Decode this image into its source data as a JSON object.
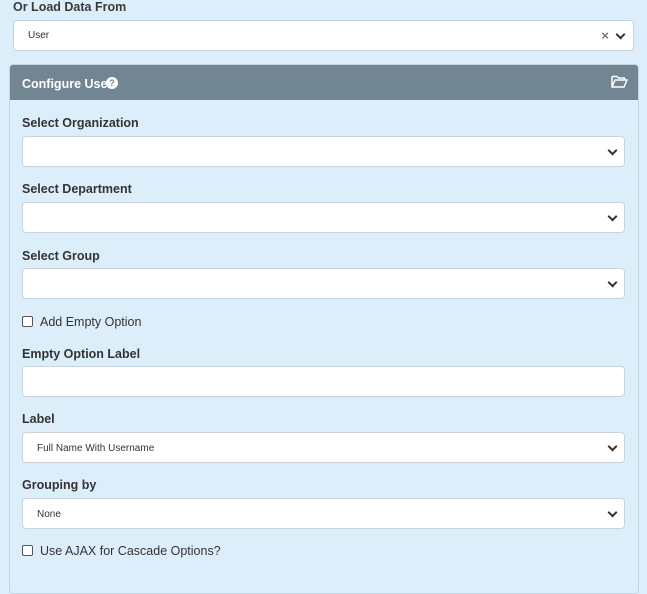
{
  "load_source": {
    "label": "Or Load Data From",
    "selected": "User",
    "clear_glyph": "×"
  },
  "panel": {
    "title": "Configure User",
    "help_glyph": "?",
    "icons": {
      "help": "question-circle-icon",
      "folder": "folder-open-icon"
    },
    "fields": {
      "organization": {
        "label": "Select Organization",
        "value": ""
      },
      "department": {
        "label": "Select Department",
        "value": ""
      },
      "group": {
        "label": "Select Group",
        "value": ""
      },
      "add_empty_option": {
        "label": "Add Empty Option",
        "checked": false
      },
      "empty_option_label": {
        "label": "Empty Option Label",
        "value": ""
      },
      "label_field": {
        "label": "Label",
        "value": "Full Name With Username"
      },
      "grouping_by": {
        "label": "Grouping by",
        "value": "None"
      },
      "use_ajax": {
        "label": "Use AJAX for Cascade Options?",
        "checked": false
      }
    }
  },
  "colors": {
    "background": "#ddeefb",
    "header": "#718593"
  }
}
